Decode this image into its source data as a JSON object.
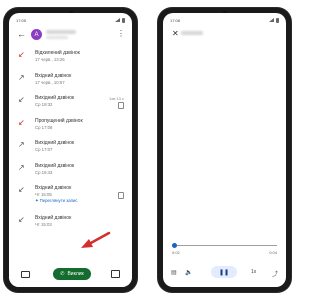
{
  "left_screen": {
    "status_time": "17:05",
    "contact_initial": "A",
    "calls": [
      {
        "type": "Відхилений дзвінок",
        "time": "17 черв., 13:26",
        "icon": "missed-call-icon",
        "duration": ""
      },
      {
        "type": "Вхідний дзвінок",
        "time": "17 черв., 10:57",
        "icon": "incoming-call-icon",
        "duration": ""
      },
      {
        "type": "Вихідний дзвінок",
        "time": "Ср 19:32",
        "icon": "outgoing-call-icon",
        "duration": "1хв 13 с"
      },
      {
        "type": "Пропущений дзвінок",
        "time": "Ср 17:08",
        "icon": "missed-call-icon",
        "duration": ""
      },
      {
        "type": "Вихідний дзвінок",
        "time": "Ср 17:07",
        "icon": "outgoing-call-icon",
        "duration": ""
      },
      {
        "type": "Вихідний дзвінок",
        "time": "Ср 16:43",
        "icon": "outgoing-call-icon",
        "duration": ""
      },
      {
        "type": "Вхідний дзвінок",
        "time": "Чт 15:05",
        "icon": "incoming-call-icon",
        "duration": ""
      },
      {
        "type": "Вхідний дзвінок",
        "time": "Чт 15:03",
        "icon": "incoming-call-icon",
        "duration": ""
      }
    ],
    "transcript_link": "Переглянути запис",
    "call_button": "Виклик",
    "accent_color": "#146c2e",
    "link_color": "#1565c0",
    "annotation_arrow_color": "#d32f2f"
  },
  "right_screen": {
    "status_time": "17:08",
    "player": {
      "current_time": "0:02",
      "total_time": "0:04",
      "speed": "1x"
    }
  }
}
